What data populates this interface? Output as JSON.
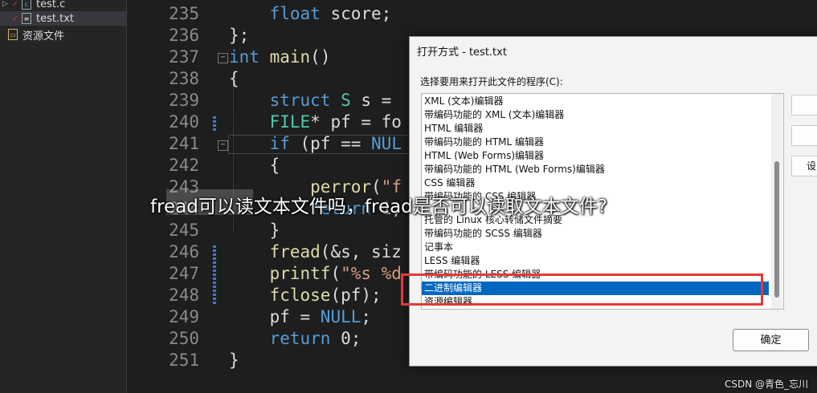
{
  "explorer": {
    "items": [
      {
        "label": "test.c"
      },
      {
        "label": "test.txt"
      },
      {
        "label": "资源文件"
      }
    ]
  },
  "editor": {
    "line_numbers": [
      "235",
      "236",
      "237",
      "238",
      "239",
      "240",
      "241",
      "242",
      "243",
      "244",
      "245",
      "246",
      "247",
      "248",
      "249",
      "250",
      "251"
    ],
    "lines": [
      "    float score;",
      "};",
      "int main()",
      "{",
      "    struct S s = ",
      "    FILE* pf = fo",
      "    if (pf == NUL",
      "    {",
      "        perror(\"f",
      "        return 1;",
      "    }",
      "    fread(&s, siz",
      "    printf(\"%s %d",
      "    fclose(pf);",
      "    pf = NULL;",
      "    return 0;",
      "}"
    ]
  },
  "dialog": {
    "title": "打开方式 - test.txt",
    "prompt": "选择要用来打开此文件的程序(C):",
    "programs": [
      "XML (文本)编辑器",
      "带编码功能的 XML (文本)编辑器",
      "HTML 编辑器",
      "带编码功能的 HTML 编辑器",
      "HTML (Web Forms)编辑器",
      "带编码功能的 HTML (Web Forms)编辑器",
      "CSS 编辑器",
      "带编码功能的 CSS 编辑器",
      "",
      "托管的 Linux 核心转储文件摘要",
      "带编码功能的 SCSS 编辑器",
      "记事本",
      "LESS 编辑器",
      "带编码功能的 LESS 编辑器",
      "二进制编辑器",
      "资源编辑器"
    ],
    "selected_index": 14,
    "side_buttons": [
      "",
      "",
      "设"
    ],
    "ok_label": "确定"
  },
  "overlay": {
    "caption": "fread可以读文本文件吗，fread是否可以读取文本文件?",
    "watermark": "CSDN @青色_忘川"
  },
  "colors": {
    "selection": "#0067c0",
    "highlight_box": "#e53935",
    "keyword": "#569cd6"
  }
}
